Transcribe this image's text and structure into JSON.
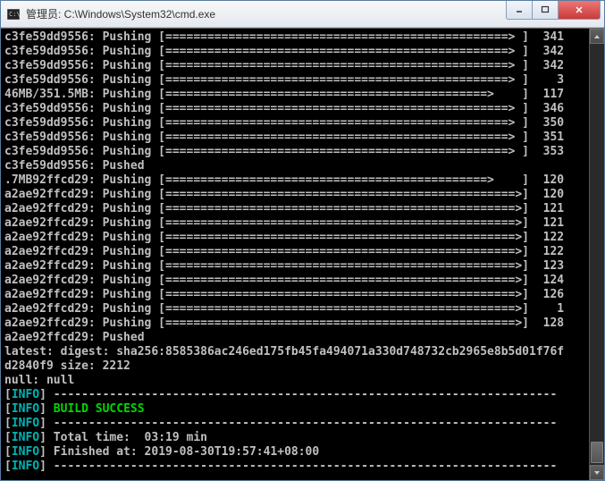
{
  "window": {
    "title": "管理员: C:\\Windows\\System32\\cmd.exe"
  },
  "bar_full": "[==================================================>]",
  "bar_near": "[=================================================> ]",
  "bar_mid": "[==============================================>    ]",
  "lines": [
    {
      "hash": "c3fe59dd9556",
      "status": "Pushing",
      "bar": "near",
      "val": "341"
    },
    {
      "hash": "c3fe59dd9556",
      "status": "Pushing",
      "bar": "near",
      "val": "342"
    },
    {
      "hash": "c3fe59dd9556",
      "status": "Pushing",
      "bar": "near",
      "val": "342"
    },
    {
      "hash": "c3fe59dd9556",
      "status": "Pushing",
      "bar": "near",
      "val": "3"
    },
    {
      "hash": "46MB/351.5MB",
      "status": "Pushing",
      "bar": "mid",
      "val": "117"
    },
    {
      "hash": "c3fe59dd9556",
      "status": "Pushing",
      "bar": "near",
      "val": "346"
    },
    {
      "hash": "c3fe59dd9556",
      "status": "Pushing",
      "bar": "near",
      "val": "350"
    },
    {
      "hash": "c3fe59dd9556",
      "status": "Pushing",
      "bar": "near",
      "val": "351"
    },
    {
      "hash": "c3fe59dd9556",
      "status": "Pushing",
      "bar": "near",
      "val": "353"
    },
    {
      "hash": "c3fe59dd9556",
      "status": "Pushed"
    },
    {
      "hash": ".7MB92ffcd29",
      "status": "Pushing",
      "bar": "mid",
      "val": "120"
    },
    {
      "hash": "a2ae92ffcd29",
      "status": "Pushing",
      "bar": "full",
      "val": "120"
    },
    {
      "hash": "a2ae92ffcd29",
      "status": "Pushing",
      "bar": "full",
      "val": "121"
    },
    {
      "hash": "a2ae92ffcd29",
      "status": "Pushing",
      "bar": "full",
      "val": "121"
    },
    {
      "hash": "a2ae92ffcd29",
      "status": "Pushing",
      "bar": "full",
      "val": "122"
    },
    {
      "hash": "a2ae92ffcd29",
      "status": "Pushing",
      "bar": "full",
      "val": "122"
    },
    {
      "hash": "a2ae92ffcd29",
      "status": "Pushing",
      "bar": "full",
      "val": "123"
    },
    {
      "hash": "a2ae92ffcd29",
      "status": "Pushing",
      "bar": "full",
      "val": "124"
    },
    {
      "hash": "a2ae92ffcd29",
      "status": "Pushing",
      "bar": "full",
      "val": "126"
    },
    {
      "hash": "a2ae92ffcd29",
      "status": "Pushing",
      "bar": "full",
      "val": "1"
    },
    {
      "hash": "a2ae92ffcd29",
      "status": "Pushing",
      "bar": "full",
      "val": "128"
    },
    {
      "hash": "a2ae92ffcd29",
      "status": "Pushed"
    }
  ],
  "digest_line1": "latest: digest: sha256:8585386ac246ed175fb45fa494071a330d748732cb2965e8b5d01f76f",
  "digest_line2": "d2840f9 size: 2212",
  "null_line": "null: null",
  "info_label": "INFO",
  "divider": "------------------------------------------------------------------------",
  "build_success": "BUILD SUCCESS",
  "total_time": "Total time:  03:19 min",
  "finished_at": "Finished at: 2019-08-30T19:57:41+08:00"
}
